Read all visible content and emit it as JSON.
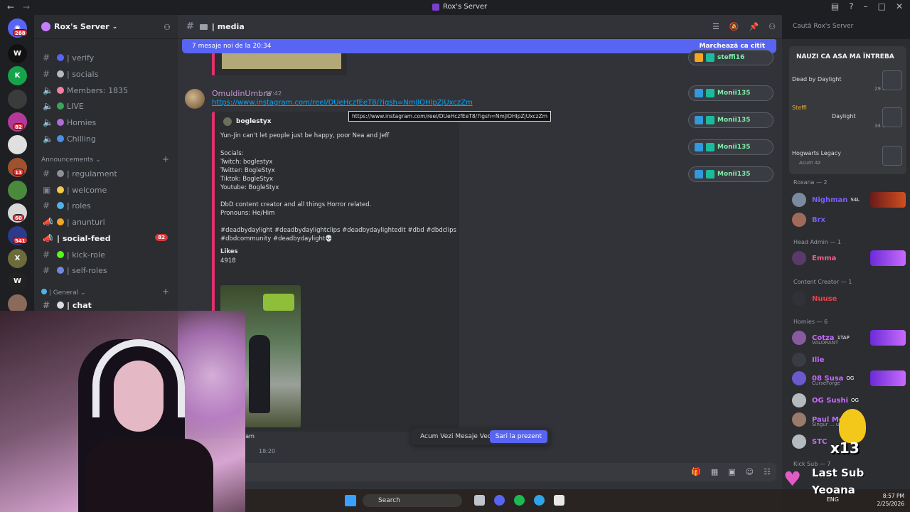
{
  "window": {
    "title": "Rox's Server"
  },
  "server": {
    "name": "Rox's Server"
  },
  "rail": {
    "badges": [
      "288",
      "82",
      "13",
      "60",
      "541"
    ]
  },
  "sidebar": {
    "channels_top": [
      {
        "name": "| verify"
      },
      {
        "name": "| socials"
      },
      {
        "name": "Members: 1835"
      },
      {
        "name": "LIVE"
      },
      {
        "name": "Homies"
      },
      {
        "name": "Chilling"
      }
    ],
    "category_announcements": "Announcements",
    "channels_ann": [
      {
        "name": "| regulament"
      },
      {
        "name": "| welcome"
      },
      {
        "name": "| roles"
      },
      {
        "name": "| anunturi"
      },
      {
        "name": "| social-feed",
        "badge": "82"
      },
      {
        "name": "| kick-role"
      },
      {
        "name": "| self-roles"
      }
    ],
    "category_general": "| General",
    "channels_gen": [
      {
        "name": "| chat"
      }
    ]
  },
  "channel": {
    "name": "| media",
    "search_placeholder": "Caută Rox's Server"
  },
  "banner": {
    "text": "7 mesaje noi de la 20:34",
    "action": "Marchează ca citit"
  },
  "message": {
    "author": "OmuldinUmbra",
    "time": "17:42",
    "link": "https://www.instagram.com/reel/DUeHczfEeT8/?igsh=NmJlOHlpZjUxczZm",
    "tooltip": "https://www.instagram.com/reel/DUeHczfEeT8/?igsh=NmJlOHlpZjUxczZm",
    "embed": {
      "author": "boglestyx",
      "lines": [
        "Yun-Jin can't let people just be happy, poor Nea and Jeff",
        "Socials:",
        "Twitch: boglestyx",
        "Twitter: BogleStyx",
        "Tiktok: BogleStyx",
        "Youtube: BogleStyx",
        "DbD content creator and all things Horror related.",
        "Pronouns: He/Him",
        "#deadbydaylight #deadbydaylightclips #deadbydaylightedit #dbd #dbdclips",
        "#dbdcommunity #deadbydaylight💀"
      ],
      "likes_label": "Likes",
      "likes_value": "4918",
      "footer": "agram"
    }
  },
  "reactions": {
    "users": [
      "steffi16",
      "Monii135",
      "Monii135",
      "Monii135",
      "Monii135"
    ]
  },
  "jump_bar": {
    "text": "Acum Vezi Mesaje Vechi",
    "button": "Sari la prezent"
  },
  "next_message_time": "18:20",
  "activity": {
    "title": "NAUZI CA ASA MA ÎNTREBA",
    "items": [
      {
        "game": "Dead by Daylight",
        "meta": "29 o"
      },
      {
        "user": "Steffi",
        "game": "Daylight",
        "meta": "34 o"
      },
      {
        "game": "Hogwarts Legacy",
        "meta": "Acum 4z"
      }
    ]
  },
  "members": {
    "roxana_header": "Roxana — 2",
    "roxana": [
      "Nighman",
      "Brx"
    ],
    "roxana_tag": "S4L",
    "head_admin_header": "Head Admin — 1",
    "head_admin": [
      "Emma"
    ],
    "content_creator_header": "Content Creator — 1",
    "content_creator": [
      "Nuuse"
    ],
    "homies_header": "Homies — 6",
    "homies": [
      {
        "name": "Cotza",
        "tag": "1TAP",
        "sub": "VALORANT"
      },
      {
        "name": "Ilie",
        "tag": "",
        "sub": ""
      },
      {
        "name": "08 Susa",
        "tag": "OG",
        "sub": "CurseForge"
      },
      {
        "name": "OG Sushi",
        "tag": "OG",
        "sub": ""
      },
      {
        "name": "Paul Mov",
        "tag": "",
        "sub": "Singur ... uinta natu"
      },
      {
        "name": "STC",
        "tag": "",
        "sub": ""
      }
    ],
    "kick_sub_header": "Kick Sub — 7"
  },
  "overlay": {
    "multiplier": "x13",
    "last_sub_label": "Last Sub",
    "last_sub_name": "Yeoana"
  },
  "taskbar": {
    "search": "Search",
    "lang": "ENG",
    "time": "8:57 PM",
    "date": "2/25/2026"
  }
}
